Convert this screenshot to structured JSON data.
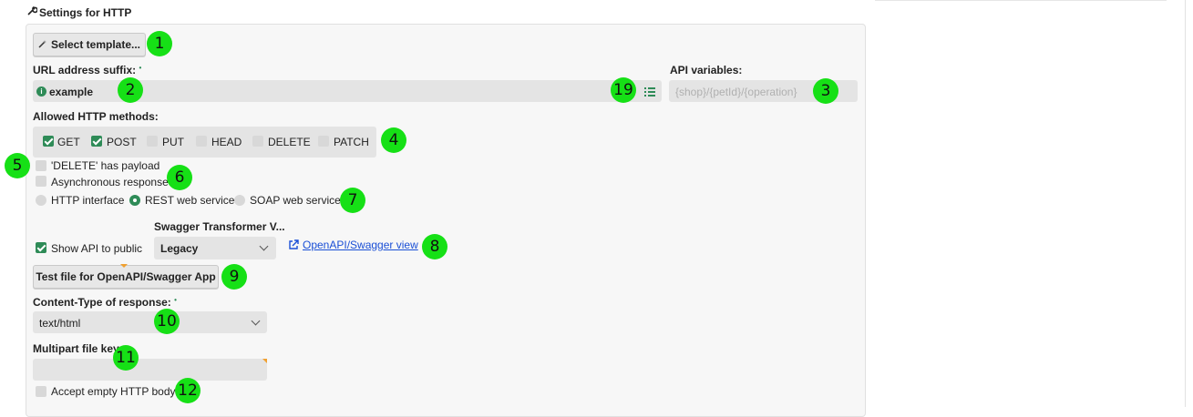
{
  "section_title": "Settings for HTTP",
  "select_template_label": "Select template...",
  "url_suffix": {
    "label": "URL address suffix:",
    "value": "example"
  },
  "api_variables": {
    "label": "API variables:",
    "placeholder": "{shop}/{petId}/{operation}"
  },
  "methods": {
    "label": "Allowed HTTP methods:",
    "items": [
      {
        "name": "GET",
        "checked": true
      },
      {
        "name": "POST",
        "checked": true
      },
      {
        "name": "PUT",
        "checked": false
      },
      {
        "name": "HEAD",
        "checked": false
      },
      {
        "name": "DELETE",
        "checked": false
      },
      {
        "name": "PATCH",
        "checked": false
      }
    ]
  },
  "delete_payload_label": "'DELETE' has payload",
  "async_label": "Asynchronous response",
  "interface_options": [
    "HTTP interface",
    "REST web service",
    "SOAP web service"
  ],
  "interface_selected": "REST web service",
  "swagger": {
    "label": "Swagger Transformer V...",
    "value": "Legacy",
    "link": "OpenAPI/Swagger view"
  },
  "show_api_label": "Show API to public",
  "test_file_label": "Test file for OpenAPI/Swagger App",
  "content_type": {
    "label": "Content-Type of response:",
    "value": "text/html"
  },
  "multipart_label": "Multipart file key:",
  "accept_empty_label": "Accept empty HTTP body",
  "badges": [
    "1",
    "2",
    "3",
    "4",
    "5",
    "6",
    "7",
    "8",
    "9",
    "10",
    "11",
    "12",
    "19"
  ],
  "colors": {
    "accent": "#2e8b57",
    "badge": "#16e016",
    "link": "#1a4fd6"
  }
}
